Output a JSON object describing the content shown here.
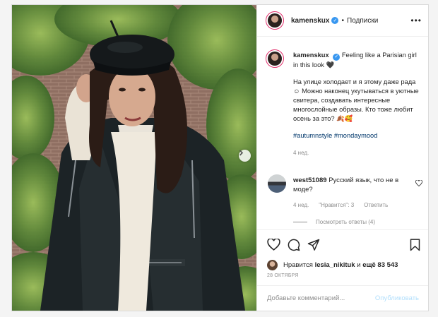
{
  "post": {
    "username": "kamenskux",
    "follow_label": "Подписки",
    "dot": "•",
    "more": "•••",
    "caption": {
      "lead": "Feeling like a Parisian girl in this look 🖤",
      "body": "На улице холодает и я этому даже рада☺ Можно наконец укутываться в уютные свитера, создавать интересные многослойные образы. Кто тоже любит осень за это? 🍂🥰",
      "hashtags": "#autumnstyle #mondaymood",
      "time": "4 нед."
    },
    "comment": {
      "username": "west51089",
      "text": "Русский язык, что не в моде?",
      "time": "4 нед.",
      "likes_label": "\"Нравится\": 3",
      "reply_label": "Ответить",
      "view_replies": "Посмотреть ответы (4)"
    },
    "likes": {
      "prefix": "Нравится",
      "user": "lesia_nikituk",
      "middle": "и",
      "others": "ещё 83 543"
    },
    "date": "28 ОКТЯБРЯ",
    "add_comment": {
      "placeholder": "Добавьте комментарий...",
      "publish_label": "Опубликовать"
    }
  },
  "icons": {
    "verified": "verified-badge-icon",
    "more": "more-options-icon",
    "like": "heart-icon",
    "comment": "comment-icon",
    "share": "share-icon",
    "save": "bookmark-icon",
    "next": "chevron-right-icon"
  },
  "colors": {
    "verified": "#3897f0",
    "hashtag": "#00376b",
    "muted": "#8e8e8e",
    "publish_disabled": "#b2dffc"
  }
}
